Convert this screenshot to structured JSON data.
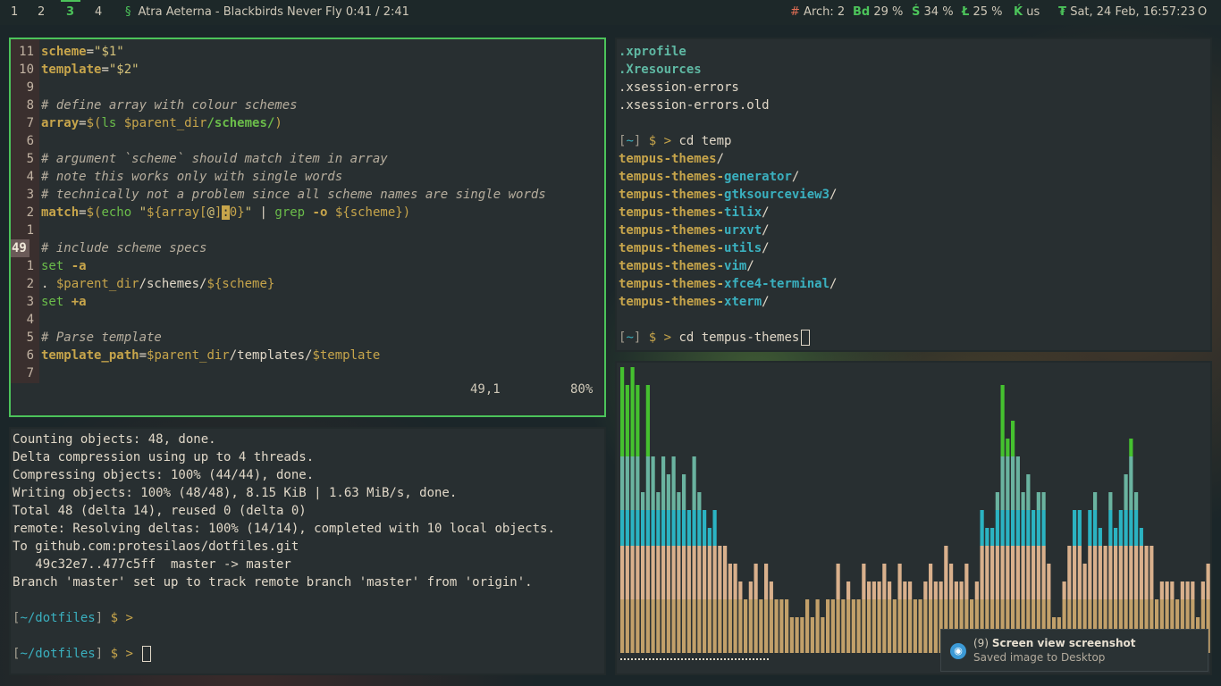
{
  "topbar": {
    "workspaces": [
      "1",
      "2",
      "3",
      "4"
    ],
    "active_workspace": "3",
    "music_glyph": "§",
    "music": "Atra Aeterna - Blackbirds Never Fly 0:41 / 2:41",
    "updates_glyph": "#",
    "updates": "Arch: 2",
    "bd_glyph": "Bd",
    "bd": "29 %",
    "s_glyph": "Ś",
    "s": "34 %",
    "l_glyph": "Ł",
    "l": "25 %",
    "kb_glyph": "Ḱ",
    "kb": "us",
    "clock_glyph": "₮",
    "clock": "Sat, 24 Feb, 16:57:23",
    "end_glyph": "O"
  },
  "vim": {
    "lines": [
      {
        "num": "11",
        "parts": [
          [
            "k",
            "scheme"
          ],
          [
            "s",
            "="
          ],
          [
            "str",
            "\"$1\""
          ]
        ]
      },
      {
        "num": "10",
        "parts": [
          [
            "k",
            "template"
          ],
          [
            "s",
            "="
          ],
          [
            "str",
            "\"$2\""
          ]
        ]
      },
      {
        "num": "9",
        "parts": []
      },
      {
        "num": "8",
        "parts": [
          [
            "cmt",
            "# define array with colour schemes"
          ]
        ]
      },
      {
        "num": "7",
        "parts": [
          [
            "k",
            "array"
          ],
          [
            "s",
            "="
          ],
          [
            "var",
            "$("
          ],
          [
            "grn",
            "ls "
          ],
          [
            "var",
            "$parent_dir"
          ],
          [
            "path",
            "/schemes/"
          ],
          [
            "var",
            ")"
          ]
        ]
      },
      {
        "num": "6",
        "parts": []
      },
      {
        "num": "5",
        "parts": [
          [
            "cmt",
            "# argument `scheme` should match item in array"
          ]
        ]
      },
      {
        "num": "4",
        "parts": [
          [
            "cmt",
            "# note this works only with single words"
          ]
        ]
      },
      {
        "num": "3",
        "parts": [
          [
            "cmt",
            "# technically not a problem since all scheme names are single words"
          ]
        ]
      },
      {
        "num": "2",
        "parts": [
          [
            "k",
            "match"
          ],
          [
            "s",
            "="
          ],
          [
            "var",
            "$("
          ],
          [
            "grn",
            "echo "
          ],
          [
            "str",
            "\""
          ],
          [
            "var",
            "${array["
          ],
          [
            "str",
            "@"
          ],
          [
            "var",
            "]"
          ],
          [
            "hl",
            ":"
          ],
          [
            "var",
            "0}"
          ],
          [
            "str",
            "\""
          ],
          [
            "s",
            " | "
          ],
          [
            "grn",
            "grep "
          ],
          [
            "k",
            "-o "
          ],
          [
            "var",
            "${scheme}"
          ],
          [
            "var",
            ")"
          ]
        ]
      },
      {
        "num": "1",
        "parts": []
      },
      {
        "num": "49",
        "cur": true,
        "parts": [
          [
            "cmt",
            "# include scheme specs"
          ]
        ]
      },
      {
        "num": "1",
        "parts": [
          [
            "grn",
            "set "
          ],
          [
            "k",
            "-a"
          ]
        ]
      },
      {
        "num": "2",
        "parts": [
          [
            "s",
            ". "
          ],
          [
            "var",
            "$parent_dir"
          ],
          [
            "s",
            "/schemes/"
          ],
          [
            "var",
            "${scheme}"
          ]
        ]
      },
      {
        "num": "3",
        "parts": [
          [
            "grn",
            "set "
          ],
          [
            "k",
            "+a"
          ]
        ]
      },
      {
        "num": "4",
        "parts": []
      },
      {
        "num": "5",
        "parts": [
          [
            "cmt",
            "# Parse template"
          ]
        ]
      },
      {
        "num": "6",
        "parts": [
          [
            "k",
            "template_path"
          ],
          [
            "s",
            "="
          ],
          [
            "var",
            "$parent_dir"
          ],
          [
            "s",
            "/templates/"
          ],
          [
            "var",
            "$template"
          ]
        ]
      },
      {
        "num": "7",
        "parts": []
      }
    ],
    "position": "49,1",
    "percent": "80%"
  },
  "git_terminal": {
    "lines": [
      "Counting objects: 48, done.",
      "Delta compression using up to 4 threads.",
      "Compressing objects: 100% (44/44), done.",
      "Writing objects: 100% (48/48), 8.15 KiB | 1.63 MiB/s, done.",
      "Total 48 (delta 14), reused 0 (delta 0)",
      "remote: Resolving deltas: 100% (14/14), completed with 10 local objects.",
      "To github.com:protesilaos/dotfiles.git",
      "   49c32e7..477c5ff  master -> master",
      "Branch 'master' set up to track remote branch 'master' from 'origin'."
    ],
    "prompt_open": "[",
    "prompt_dir": "~/dotfiles",
    "prompt_close": "]",
    "prompt_sym": "$ >"
  },
  "ls_terminal": {
    "files": [
      {
        "name": ".xprofile",
        "style": "bold"
      },
      {
        "name": ".Xresources",
        "style": "bold"
      },
      {
        "name": ".xsession-errors",
        "style": "plain"
      },
      {
        "name": ".xsession-errors.old",
        "style": "plain"
      }
    ],
    "cmd1": "cd temp",
    "dirs": [
      {
        "a": "tempus-themes",
        "b": "",
        "slash": "/"
      },
      {
        "a": "tempus-themes-",
        "b": "generator",
        "slash": "/"
      },
      {
        "a": "tempus-themes-",
        "b": "gtksourceview3",
        "slash": "/"
      },
      {
        "a": "tempus-themes-",
        "b": "tilix",
        "slash": "/"
      },
      {
        "a": "tempus-themes-",
        "b": "urxvt",
        "slash": "/"
      },
      {
        "a": "tempus-themes-",
        "b": "utils",
        "slash": "/"
      },
      {
        "a": "tempus-themes-",
        "b": "vim",
        "slash": "/"
      },
      {
        "a": "tempus-themes-",
        "b": "xfce4-terminal",
        "slash": "/"
      },
      {
        "a": "tempus-themes-",
        "b": "xterm",
        "slash": "/"
      }
    ],
    "prompt_open": "[",
    "prompt_dir": "~",
    "prompt_close": "]",
    "prompt_sym": "$ >",
    "cmd2": "cd tempus-themes"
  },
  "visualizer": {
    "colors": {
      "low": "#c2a06a",
      "mid": "#d9b08c",
      "cyan": "#2bb3c2",
      "teal": "#6ab3a0",
      "green": "#45c12f"
    },
    "chart_data": {
      "type": "bar",
      "values": [
        16,
        15,
        16,
        15,
        9,
        15,
        11,
        9,
        11,
        10,
        11,
        9,
        10,
        8,
        11,
        9,
        8,
        7,
        8,
        6,
        6,
        5,
        5,
        4,
        3,
        4,
        5,
        3,
        5,
        4,
        3,
        3,
        3,
        2,
        2,
        2,
        3,
        2,
        3,
        2,
        3,
        3,
        5,
        3,
        4,
        3,
        3,
        5,
        4,
        4,
        4,
        5,
        4,
        3,
        5,
        4,
        4,
        3,
        3,
        4,
        5,
        4,
        4,
        6,
        5,
        4,
        4,
        5,
        3,
        4,
        8,
        7,
        7,
        9,
        15,
        12,
        13,
        11,
        9,
        10,
        8,
        9,
        9,
        5,
        2,
        2,
        4,
        6,
        8,
        8,
        5,
        8,
        9,
        7,
        6,
        9,
        7,
        8,
        10,
        12,
        9,
        7,
        6,
        6,
        3,
        4,
        4,
        4,
        3,
        4,
        4,
        4,
        2,
        4,
        5,
        5
      ],
      "dashed_progress": 0.25
    }
  },
  "notification": {
    "icon": "camera-icon",
    "count": "(9)",
    "title": "Screen view screenshot",
    "body": "Saved image to Desktop"
  }
}
